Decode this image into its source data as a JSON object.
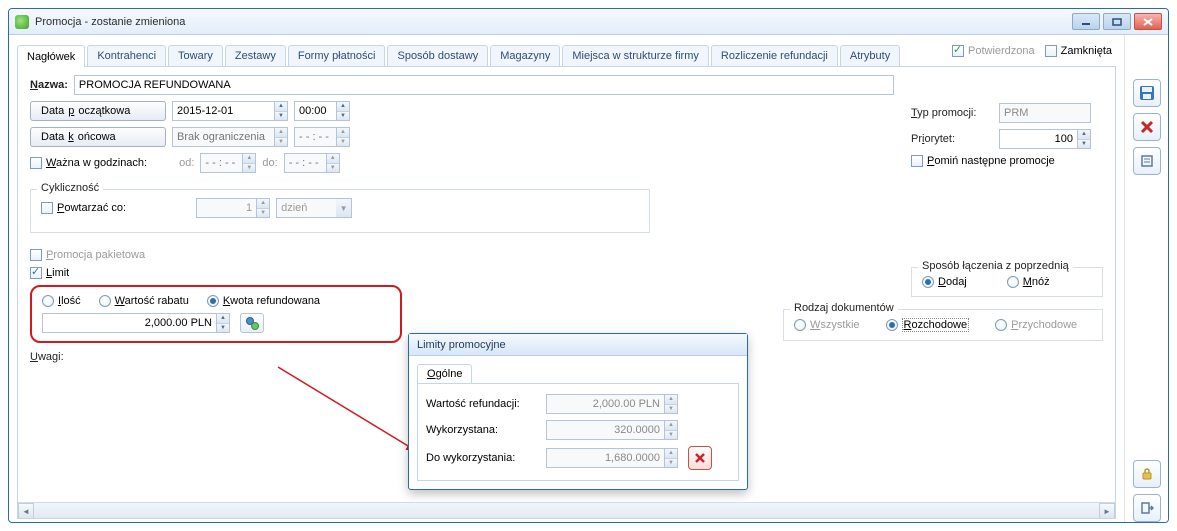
{
  "window": {
    "title": "Promocja - zostanie zmieniona"
  },
  "tabs": {
    "items": [
      "Nagłówek",
      "Kontrahenci",
      "Towary",
      "Zestawy",
      "Formy płatności",
      "Sposób dostawy",
      "Magazyny",
      "Miejsca w strukturze firmy",
      "Rozliczenie refundacji",
      "Atrybuty"
    ],
    "confirmed": "Potwierdzona",
    "closed": "Zamknięta"
  },
  "header": {
    "name_label_pre": "N",
    "name_label_rest": "azwa:",
    "name_value": "PROMOCJA REFUNDOWANA",
    "start_label_pre": "Data ",
    "start_label_u": "p",
    "start_label_post": "oczątkowa",
    "end_label_pre": "Data ",
    "end_label_u": "k",
    "end_label_post": "ońcowa",
    "start_date": "2015-12-01",
    "start_time": "00:00",
    "end_date_placeholder": "Brak ograniczenia",
    "end_time_placeholder": "- - : - -",
    "hours_check_u": "W",
    "hours_check_rest": "ażna w godzinach:",
    "hours_from": "od:",
    "hours_to": "do:",
    "hours_ph": "- - : - -"
  },
  "cyclic": {
    "legend": "Cykliczność",
    "repeat_u": "P",
    "repeat_rest": "owtarzać co:",
    "val": "1",
    "unit": "dzień"
  },
  "flags": {
    "package_u": "P",
    "package_rest": "romocja pakietowa",
    "limit_u": "L",
    "limit_rest": "imit"
  },
  "limit": {
    "ilosc_u": "I",
    "ilosc_rest": "lość",
    "wartosc_u": "W",
    "wartosc_rest": "artość rabatu",
    "kwota_u": "K",
    "kwota_rest": "wota refundowana",
    "value": "2,000.00 PLN"
  },
  "remarks": {
    "label_u": "U",
    "label_rest": "wagi:"
  },
  "right": {
    "type_u": "T",
    "type_rest": "yp promocji:",
    "type_val": "PRM",
    "prio_u": "i",
    "prio_pre": "Pr",
    "prio_post": "orytet:",
    "prio_val": "100",
    "skip_u": "P",
    "skip_rest": "omiń następne promocje",
    "merge_legend": "Sposób łączenia z poprzednią",
    "add_u": "D",
    "add_rest": "odaj",
    "mul_u": "M",
    "mul_rest": "nóż",
    "doc_legend": "Rodzaj dokumentów",
    "all_u": "W",
    "all_rest": "szystkie",
    "out_u": "R",
    "out_rest": "ozchodowe",
    "in_u": "P",
    "in_rest": "rzychodowe"
  },
  "dialog": {
    "title": "Limity promocyjne",
    "tab_u": "O",
    "tab_rest": "gólne",
    "r1": "Wartość refundacji:",
    "r1v": "2,000.00 PLN",
    "r2": "Wykorzystana:",
    "r2v": "320.0000",
    "r3": "Do wykorzystania:",
    "r3v": "1,680.0000"
  }
}
